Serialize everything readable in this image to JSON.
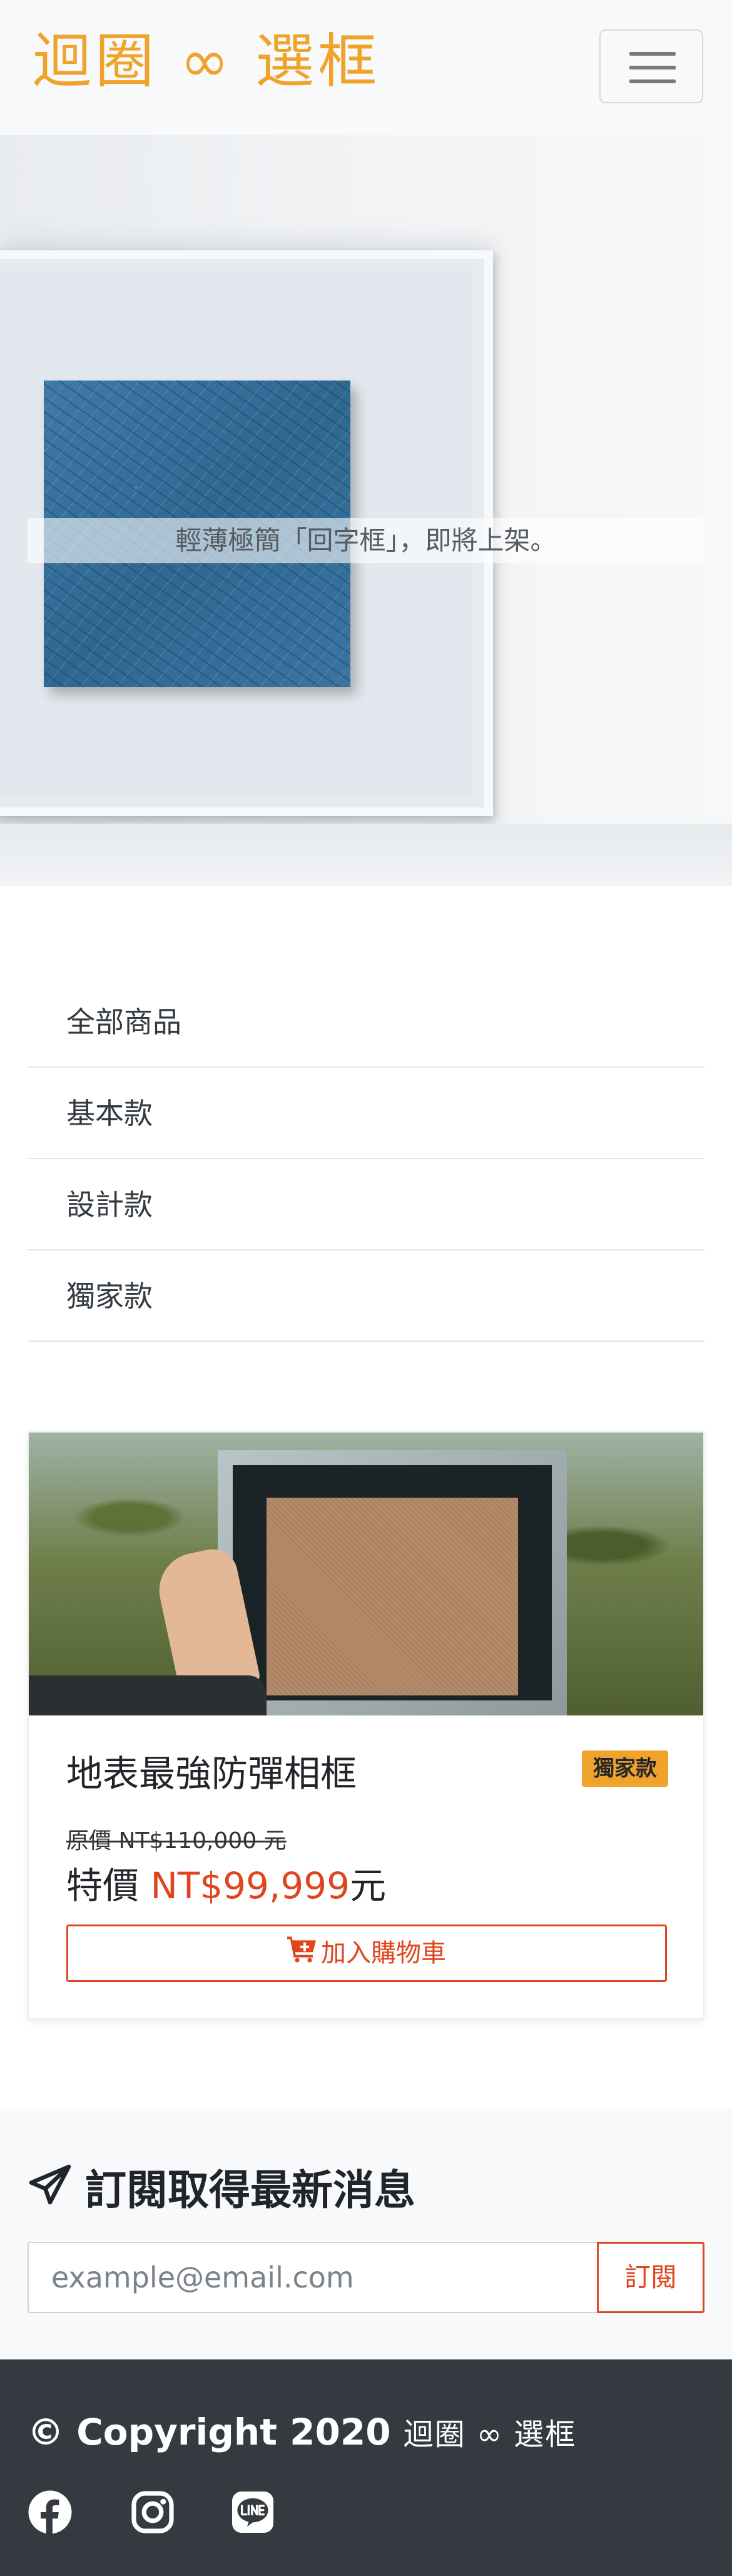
{
  "navbar": {
    "brand": "迴圈 ∞ 選框",
    "toggler_icon": "hamburger-menu-icon"
  },
  "hero": {
    "caption": "輕薄極簡「回字框」，即將上架。"
  },
  "categories": {
    "items": [
      {
        "label": "全部商品"
      },
      {
        "label": "基本款"
      },
      {
        "label": "設計款"
      },
      {
        "label": "獨家款"
      }
    ]
  },
  "product": {
    "title": "地表最強防彈相框",
    "badge": "獨家款",
    "original_price": "原價 NT$110,000 元",
    "sale_prefix": "特價 ",
    "sale_amount": "NT$99,999",
    "sale_suffix": "元",
    "cart_icon": "cart-plus-icon",
    "cart_label": "加入購物車"
  },
  "subscribe": {
    "icon": "paper-plane-icon",
    "title": "訂閱取得最新消息",
    "placeholder": "example@email.com",
    "button_label": "訂閱"
  },
  "footer": {
    "copyright": "© Copyright 2020",
    "brand": "迴圈 ∞ 選框",
    "social": [
      {
        "icon": "facebook-icon"
      },
      {
        "icon": "instagram-icon"
      },
      {
        "icon": "line-icon"
      }
    ]
  },
  "colors": {
    "brand": "#f0a32b",
    "accent": "#e0451f",
    "footer_bg": "#343a40",
    "light_bg": "#f8f9fa"
  }
}
